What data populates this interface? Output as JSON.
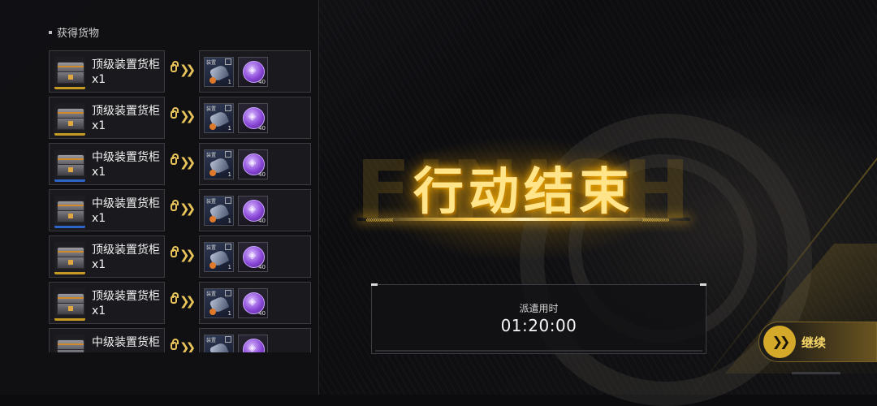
{
  "section_title": "获得货物",
  "rows": [
    {
      "name": "顶级装置货柜\nx1",
      "tier": "top",
      "equip_tag": "装置",
      "equip_qty": "1",
      "orb_qty": "40"
    },
    {
      "name": "顶级装置货柜\nx1",
      "tier": "top",
      "equip_tag": "装置",
      "equip_qty": "1",
      "orb_qty": "40"
    },
    {
      "name": "中级装置货柜\nx1",
      "tier": "mid",
      "equip_tag": "装置",
      "equip_qty": "1",
      "orb_qty": "40"
    },
    {
      "name": "中级装置货柜\nx1",
      "tier": "mid",
      "equip_tag": "装置",
      "equip_qty": "1",
      "orb_qty": "40"
    },
    {
      "name": "顶级装置货柜\nx1",
      "tier": "top",
      "equip_tag": "装置",
      "equip_qty": "1",
      "orb_qty": "40"
    },
    {
      "name": "顶级装置货柜\nx1",
      "tier": "top",
      "equip_tag": "装置",
      "equip_qty": "1",
      "orb_qty": "40"
    },
    {
      "name": "中级装置货柜",
      "tier": "mid",
      "equip_tag": "装置",
      "equip_qty": "",
      "orb_qty": ""
    }
  ],
  "banner": {
    "title": "行动结束",
    "bg_word": "FINISH"
  },
  "dispatch": {
    "label": "派遣用时",
    "time": "01:20:00"
  },
  "continue_label": "继续",
  "colors": {
    "accent_gold": "#d4a92a",
    "top_tier": "#c69b23",
    "mid_tier": "#2d64c8",
    "orb_purple": "#8a48d8"
  }
}
